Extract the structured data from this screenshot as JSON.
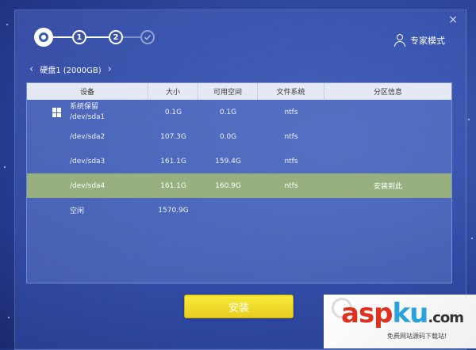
{
  "window": {
    "close_symbol": "×"
  },
  "steps": [
    "1",
    "2"
  ],
  "expert_mode": "专家模式",
  "disk": {
    "label": "硬盘1 (2000GB)"
  },
  "table": {
    "headers": [
      "设备",
      "大小",
      "可用空间",
      "文件系统",
      "分区信息"
    ],
    "rows": [
      {
        "device_label": "系统保留",
        "device": "/dev/sda1",
        "size": "0.1G",
        "free": "0.1G",
        "fs": "ntfs",
        "info": ""
      },
      {
        "device": "/dev/sda2",
        "size": "107.3G",
        "free": "0.0G",
        "fs": "ntfs",
        "info": ""
      },
      {
        "device": "/dev/sda3",
        "size": "161.1G",
        "free": "159.4G",
        "fs": "ntfs",
        "info": ""
      },
      {
        "device": "/dev/sda4",
        "size": "161.1G",
        "free": "160.9G",
        "fs": "ntfs",
        "info": "安装到此",
        "selected": true
      },
      {
        "device": "空闲",
        "size": "1570.9G",
        "free": "",
        "fs": "",
        "info": ""
      }
    ]
  },
  "install_button": "安装",
  "watermark": {
    "brand_a": "asp",
    "brand_b": "ku",
    "brand_c": ".com",
    "tagline": "免费网站源码下载站!"
  },
  "colors": {
    "accent_selected": "#98b07f",
    "install_button": "#f2e030",
    "background": "#2f4aa0"
  }
}
